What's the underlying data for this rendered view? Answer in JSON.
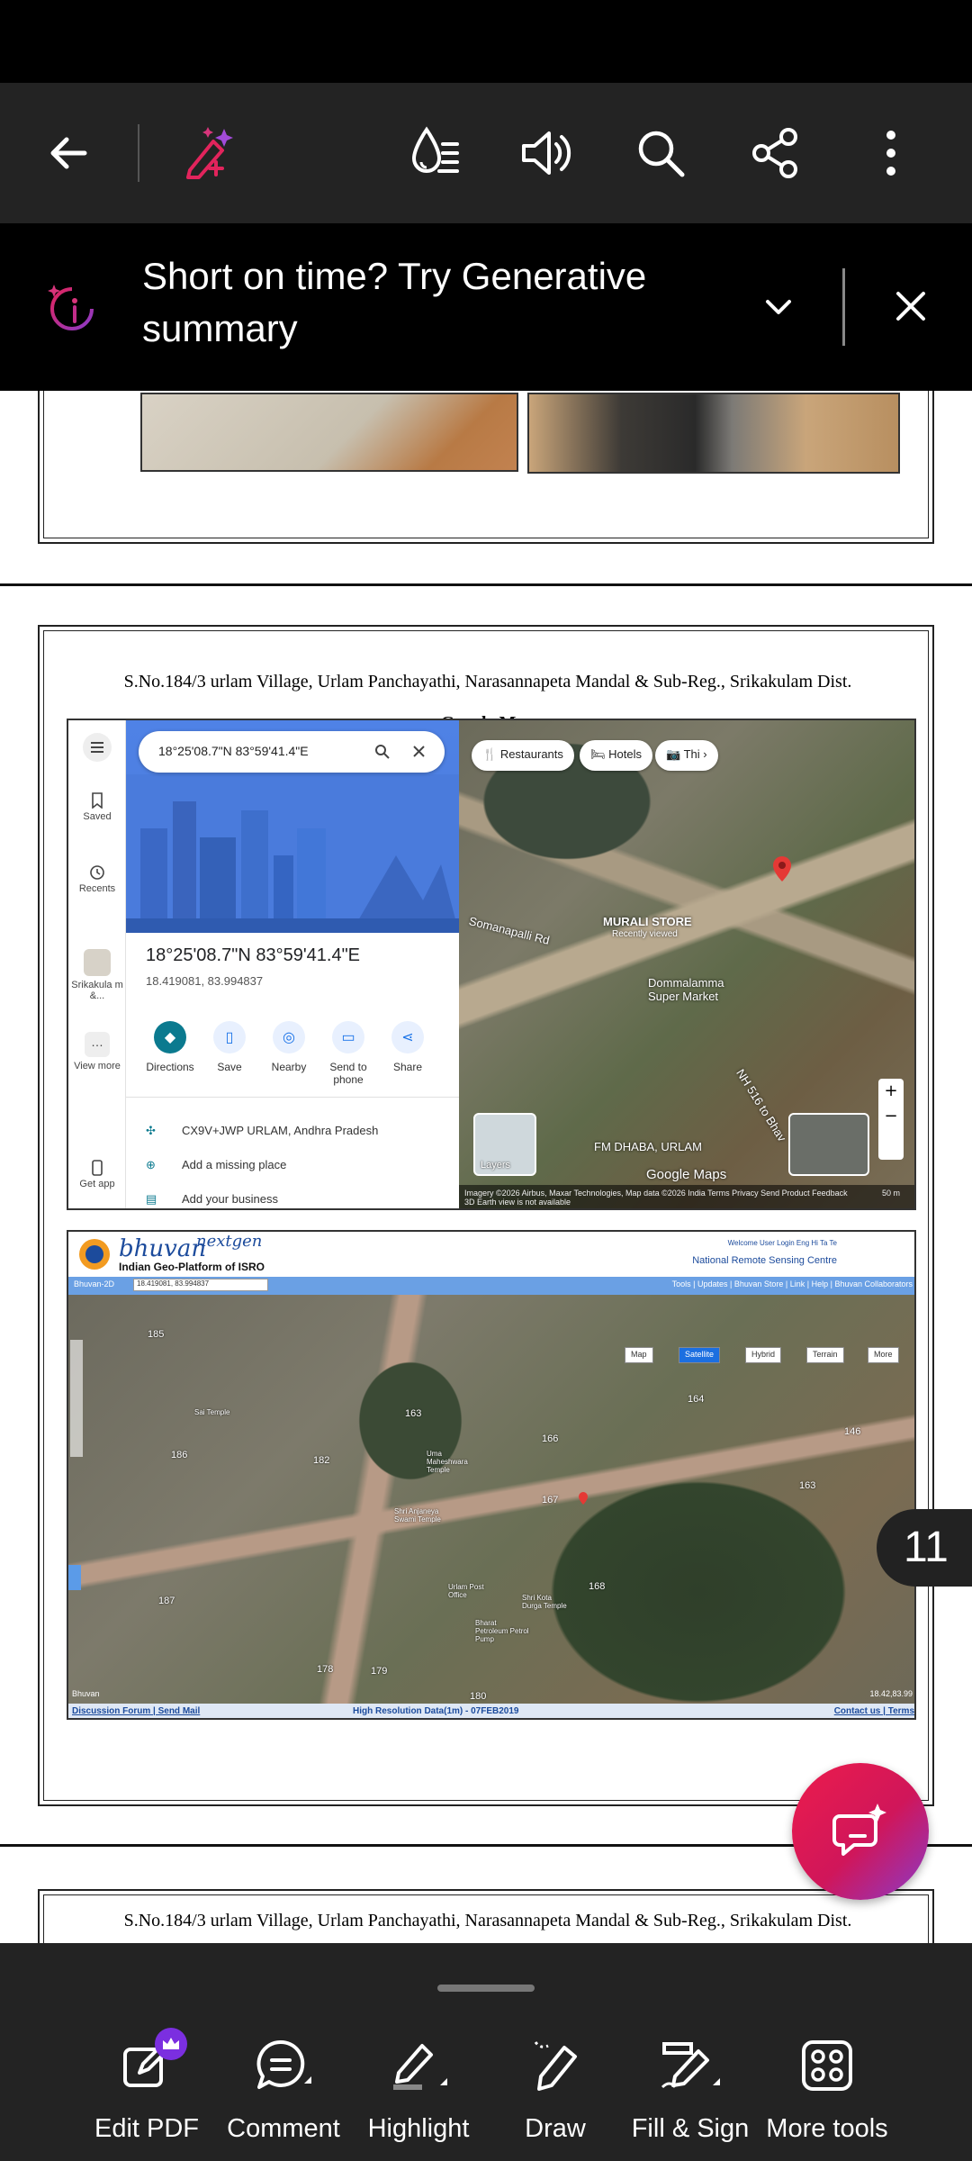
{
  "toolbar": {
    "back_icon": "arrow-left-icon",
    "ai_icon": "generative-ai-icon",
    "icons": [
      "liquid-mode-icon",
      "read-aloud-icon",
      "search-icon",
      "share-icon",
      "more-vertical-icon"
    ]
  },
  "gen_banner": {
    "text": "Short on time? Try Generative summary"
  },
  "document": {
    "page_header": "S.No.184/3 urlam Village, Urlam Panchayathi, Narasannapeta Mandal & Sub-Reg., Srikakulam Dist.",
    "map_title": "Google Map",
    "next_page_header": "S.No.184/3 urlam Village, Urlam Panchayathi, Narasannapeta Mandal & Sub-Reg., Srikakulam Dist."
  },
  "google_map": {
    "search_value": "18°25'08.7\"N 83°59'41.4\"E",
    "rail": [
      "Saved",
      "Recents",
      "Srikakula m &...",
      "View more",
      "Get app"
    ],
    "coord_title": "18°25'08.7\"N 83°59'41.4\"E",
    "coord_decimal": "18.419081, 83.994837",
    "actions": [
      "Directions",
      "Save",
      "Nearby",
      "Send to phone",
      "Share"
    ],
    "list": [
      "CX9V+JWP URLAM, Andhra Pradesh",
      "Add a missing place",
      "Add your business"
    ],
    "chips": [
      "Restaurants",
      "Hotels",
      "Thi"
    ],
    "labels": {
      "mural_store": "MURALI STORE",
      "mural_sub": "Recently viewed",
      "super_market": "Dommalamma Super Market",
      "fm_dhaba": "FM DHABA, URLAM",
      "road1": "Somanapalli Rd",
      "road2": "NH 516 to Bhav",
      "google": "Google Maps",
      "layers": "Layers"
    },
    "attribution": "Imagery ©2026 Airbus, Maxar Technologies, Map data ©2026   India   Terms   Privacy   Send Product Feedback",
    "scale": "50 m",
    "earth_note": "3D Earth view is not available"
  },
  "bhuvan": {
    "logo": "bhuvan",
    "logo_suffix": "nextgen",
    "tagline": "Indian Geo-Platform of ISRO",
    "welcome": "Welcome User  Login   Eng  Hi  Ta  Te",
    "nrsc": "National Remote Sensing Centre",
    "nav_left": "Bhuvan-2D",
    "search_value": "18.419081, 83.994837",
    "nav_links": "Tools | Updates | Bhuvan Store | Link | Help | Bhuvan Collaborators",
    "map_types": [
      "Map",
      "Satellite",
      "Hybrid",
      "Terrain",
      "More"
    ],
    "parcels": [
      "163",
      "164",
      "166",
      "167",
      "168",
      "146",
      "163",
      "178",
      "179",
      "180",
      "187",
      "185",
      "186",
      "182"
    ],
    "places": [
      "Uma Maheshwara Temple",
      "Shri Anjaneya Swami Temple",
      "Urlam Post Office",
      "Shri Kota Durga Temple",
      "Bharat Petroleum Petrol Pump",
      "Sai Temple"
    ],
    "footer_left": "Discussion Forum | Send Mail",
    "footer_mid": "High Resolution Data(1m) - 07FEB2019",
    "footer_right": "Contact us | Terms",
    "coords": "18.42,83.99",
    "brand": "Bhuvan"
  },
  "page_badge": "11",
  "fab_icon": "ai-assistant-icon",
  "bottom_bar": {
    "items": [
      {
        "label": "Edit PDF",
        "icon": "edit-pdf-icon"
      },
      {
        "label": "Comment",
        "icon": "comment-icon"
      },
      {
        "label": "Highlight",
        "icon": "highlight-icon"
      },
      {
        "label": "Draw",
        "icon": "draw-icon"
      },
      {
        "label": "Fill & Sign",
        "icon": "fill-sign-icon"
      },
      {
        "label": "More tools",
        "icon": "more-tools-icon"
      }
    ]
  },
  "colors": {
    "accent": "#e2245c",
    "toolbar_bg": "#232323",
    "banner_bg": "#000000"
  }
}
